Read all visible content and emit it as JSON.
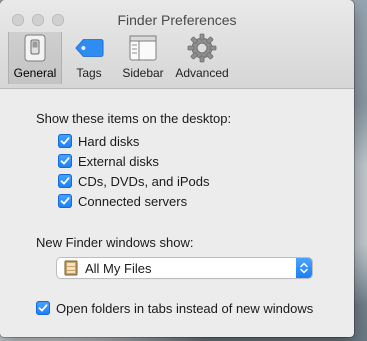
{
  "window": {
    "title": "Finder Preferences"
  },
  "toolbar": {
    "tabs": [
      {
        "label": "General",
        "icon": "general-switch-icon",
        "selected": true
      },
      {
        "label": "Tags",
        "icon": "tag-icon",
        "selected": false
      },
      {
        "label": "Sidebar",
        "icon": "sidebar-icon",
        "selected": false
      },
      {
        "label": "Advanced",
        "icon": "gear-icon",
        "selected": false
      }
    ]
  },
  "desktop_section": {
    "heading": "Show these items on the desktop:",
    "items": [
      {
        "label": "Hard disks",
        "checked": true
      },
      {
        "label": "External disks",
        "checked": true
      },
      {
        "label": "CDs, DVDs, and iPods",
        "checked": true
      },
      {
        "label": "Connected servers",
        "checked": true
      }
    ]
  },
  "new_window_section": {
    "heading": "New Finder windows show:",
    "selected_value": "All My Files",
    "icon": "all-my-files-icon"
  },
  "tabs_option": {
    "label": "Open folders in tabs instead of new windows",
    "checked": true
  },
  "colors": {
    "accent": "#1a7ff5"
  }
}
